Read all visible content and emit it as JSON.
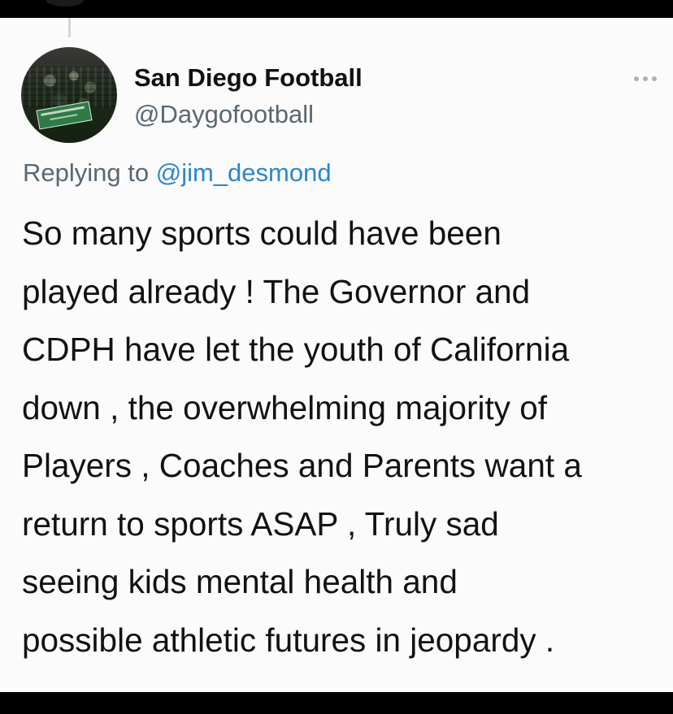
{
  "tweet": {
    "author": {
      "display_name": "San Diego Football",
      "handle": "@Daygofootball",
      "avatar_icon": "team-photo-avatar"
    },
    "reply": {
      "prefix": "Replying to",
      "to": "@jim_desmond"
    },
    "body_lines": [
      "So many sports could have been",
      "played already ! The Governor and",
      "CDPH have let the youth of California",
      "down , the overwhelming majority of",
      "Players , Coaches and Parents want a",
      "return to sports ASAP , Truly sad",
      "seeing kids mental health and",
      "possible athletic futures in jeopardy ."
    ],
    "more_icon": "more-options-icon"
  },
  "colors": {
    "card_background": "#fbfbfb",
    "frame": "#000000",
    "primary_text": "#111111",
    "secondary_text": "#5b6770",
    "link": "#2b86c9"
  }
}
